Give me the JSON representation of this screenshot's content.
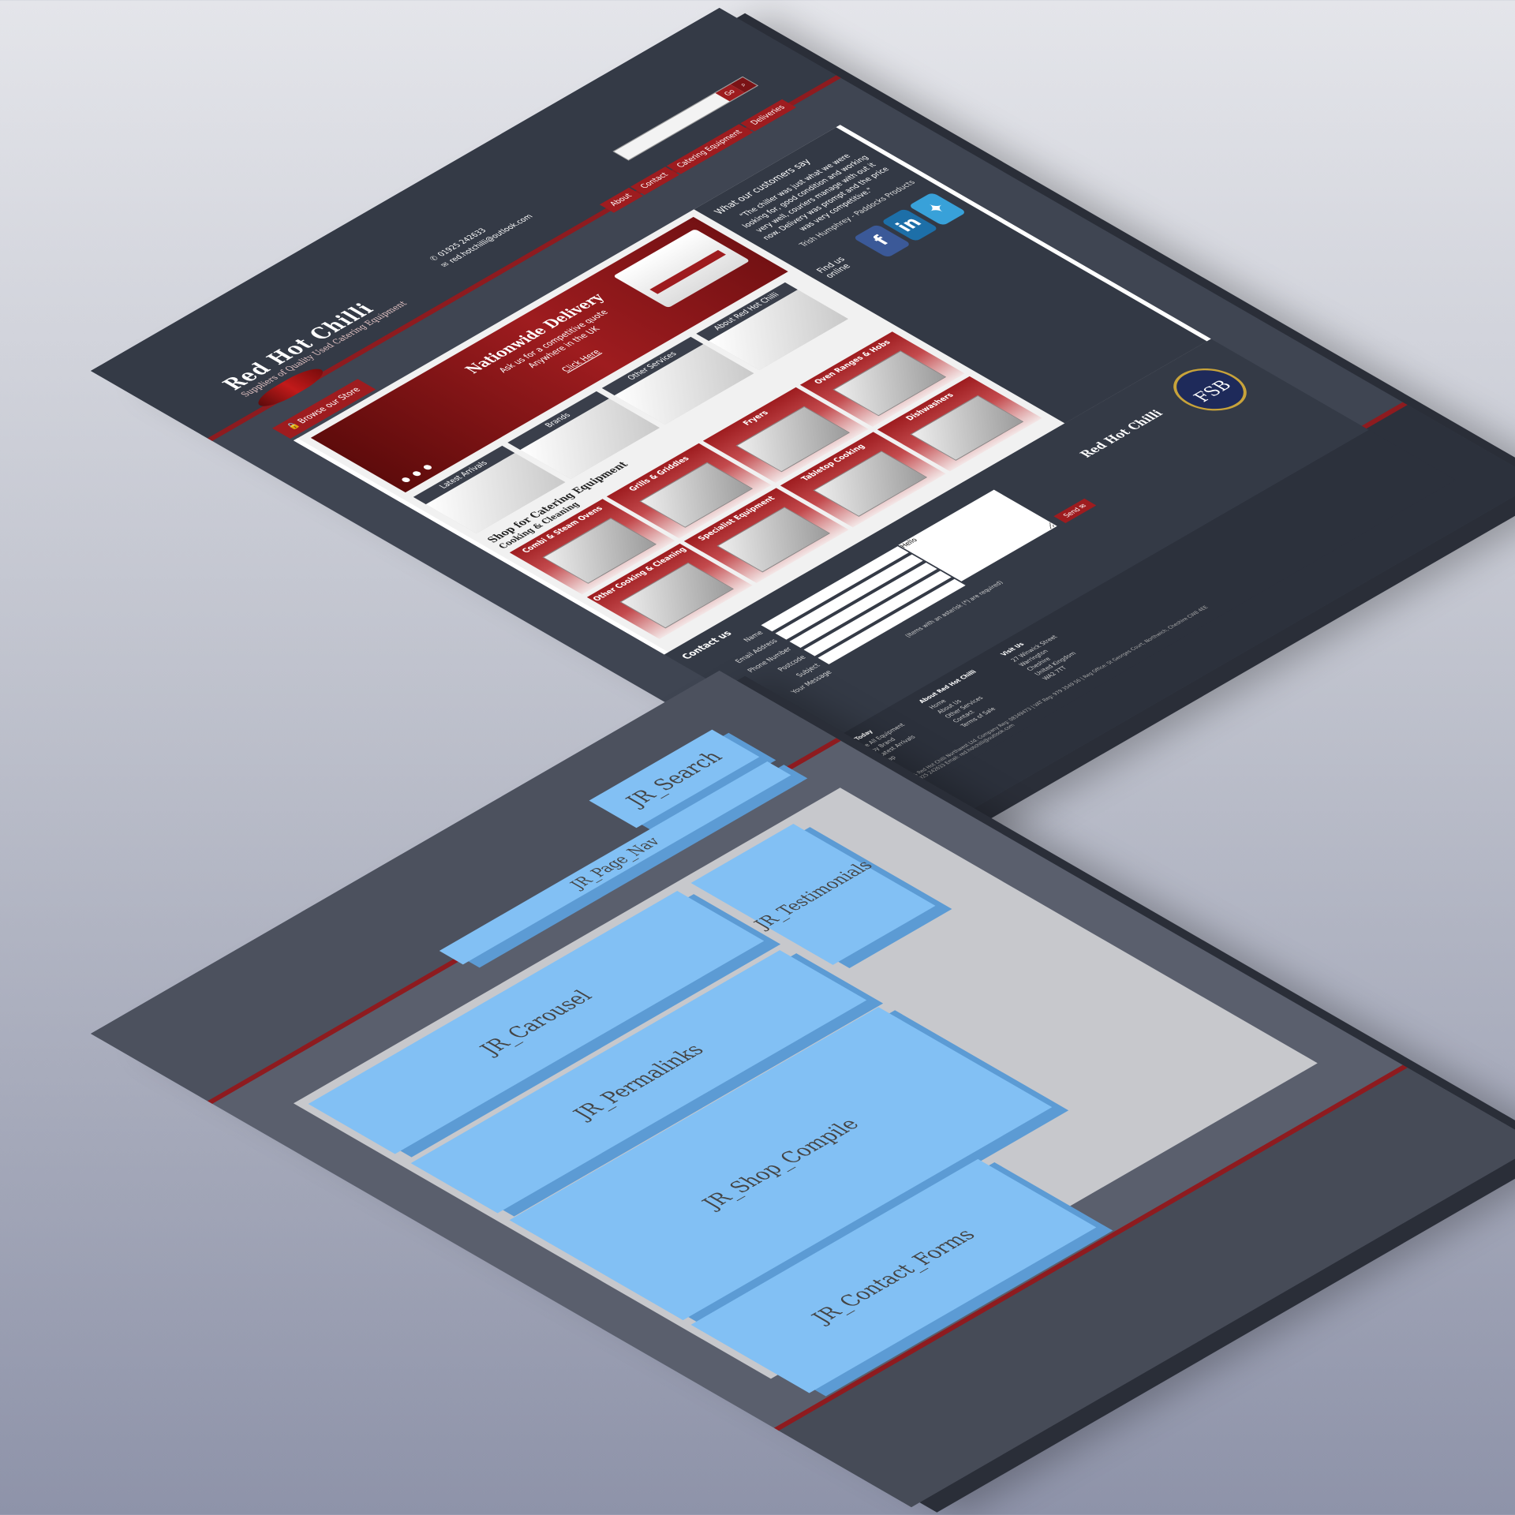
{
  "header": {
    "brand": "Red Hot Chilli",
    "tagline": "Suppliers of Quality Used Catering Equipment",
    "phone": "01925 242633",
    "email": "red.hotchilli@outlook.com",
    "search_button": "Go",
    "browse_label": "Browse our Store",
    "nav": [
      "About",
      "Contact",
      "Catering Equipment",
      "Deliveries"
    ]
  },
  "carousel": {
    "title": "Nationwide Delivery",
    "text": "Ask us for a competitive quote Anywhere in the UK",
    "link": "Click Here"
  },
  "permalinks": [
    {
      "label": "Latest Arrivals"
    },
    {
      "label": "Brands"
    },
    {
      "label": "Other Services"
    },
    {
      "label": "About Red Hot Chilli"
    }
  ],
  "shop": {
    "title": "Shop for Catering Equipment",
    "subtitle": "Cooking & Cleaning",
    "categories": [
      "Combi & Steam Ovens",
      "Grills & Griddles",
      "Fryers",
      "Oven Ranges & Hobs",
      "Other Cooking & Cleaning",
      "Specialist Equipment",
      "Tabletop Cooking",
      "Dishwashers"
    ]
  },
  "testimonials": {
    "title": "What our customers say",
    "quote": "\"The chiller was just what we were looking for, good condition and working very well, couriers manage with out it now. Delivery was prompt and the price was very competitive.\"",
    "author": "Trish Humphrey - Paddocks Products"
  },
  "social": {
    "label": "Find us online",
    "icons": [
      "facebook-icon",
      "linkedin-icon",
      "twitter-icon"
    ]
  },
  "contact": {
    "title": "Contact us",
    "fields": [
      "Name",
      "Email Address",
      "Phone Number",
      "Postcode",
      "Subject",
      "Your Message"
    ],
    "message_value": "Hello",
    "send": "Send",
    "note": "(Items with an asterisk (*) are required)"
  },
  "footer": {
    "brand": "Red Hot Chilli",
    "fsb": "FSB",
    "cols": [
      {
        "title": "Shop Today",
        "items": [
          "Browse All Equipment",
          "Shop by Brand",
          "View Latest Arrivals",
          "Sitemap"
        ]
      },
      {
        "title": "About Red Hot Chilli",
        "items": [
          "Home",
          "About Us",
          "Other Services",
          "Contact",
          "Terms of Sale"
        ]
      },
      {
        "title": "Visit Us",
        "items": [
          "27 Winwick Street",
          "Warrington",
          "Cheshire",
          "United Kingdom",
          "WA2 7TT"
        ]
      }
    ],
    "copyright": "© 2015 Red Hot Chilli Northwest Ltd. Company Reg: 08349473 | VAT Reg: 979 3549 56 | Reg Office: St Georges Court, Northwich, Cheshire CW8 4EE",
    "contact_line": "Tel: 01925 242633 Email: red.hotchilli@outlook.com"
  },
  "modules": [
    "JR_Search",
    "JR_Page_Nav",
    "JR_Carousel",
    "JR_Permalinks",
    "JR_Shop_Compile",
    "JR_Testimonials",
    "JR_Contact_Forms"
  ]
}
